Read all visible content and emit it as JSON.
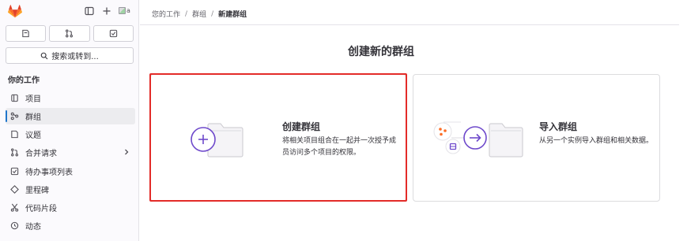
{
  "app": {
    "brand_color": "#e24329",
    "highlight_color": "#e32b28",
    "accent": "#6e49cb"
  },
  "sidebar": {
    "avatar_alt": "a",
    "search_label": "搜索或转到...",
    "section_title": "你的工作",
    "items": [
      {
        "label": "项目",
        "icon": "project-icon"
      },
      {
        "label": "群组",
        "icon": "group-icon",
        "active": true
      },
      {
        "label": "议题",
        "icon": "issues-icon"
      },
      {
        "label": "合并请求",
        "icon": "merge-request-icon",
        "has_chevron": true
      },
      {
        "label": "待办事项列表",
        "icon": "todo-icon"
      },
      {
        "label": "里程碑",
        "icon": "milestone-icon"
      },
      {
        "label": "代码片段",
        "icon": "snippet-icon"
      },
      {
        "label": "动态",
        "icon": "activity-icon"
      }
    ]
  },
  "breadcrumb": {
    "items": [
      "您的工作",
      "群组",
      "新建群组"
    ]
  },
  "main": {
    "title": "创建新的群组",
    "cards": [
      {
        "title": "创建群组",
        "desc": "将相关项目组合在一起并一次授予成员访问多个项目的权限。"
      },
      {
        "title": "导入群组",
        "desc": "从另一个实例导入群组和相关数据。"
      }
    ]
  }
}
